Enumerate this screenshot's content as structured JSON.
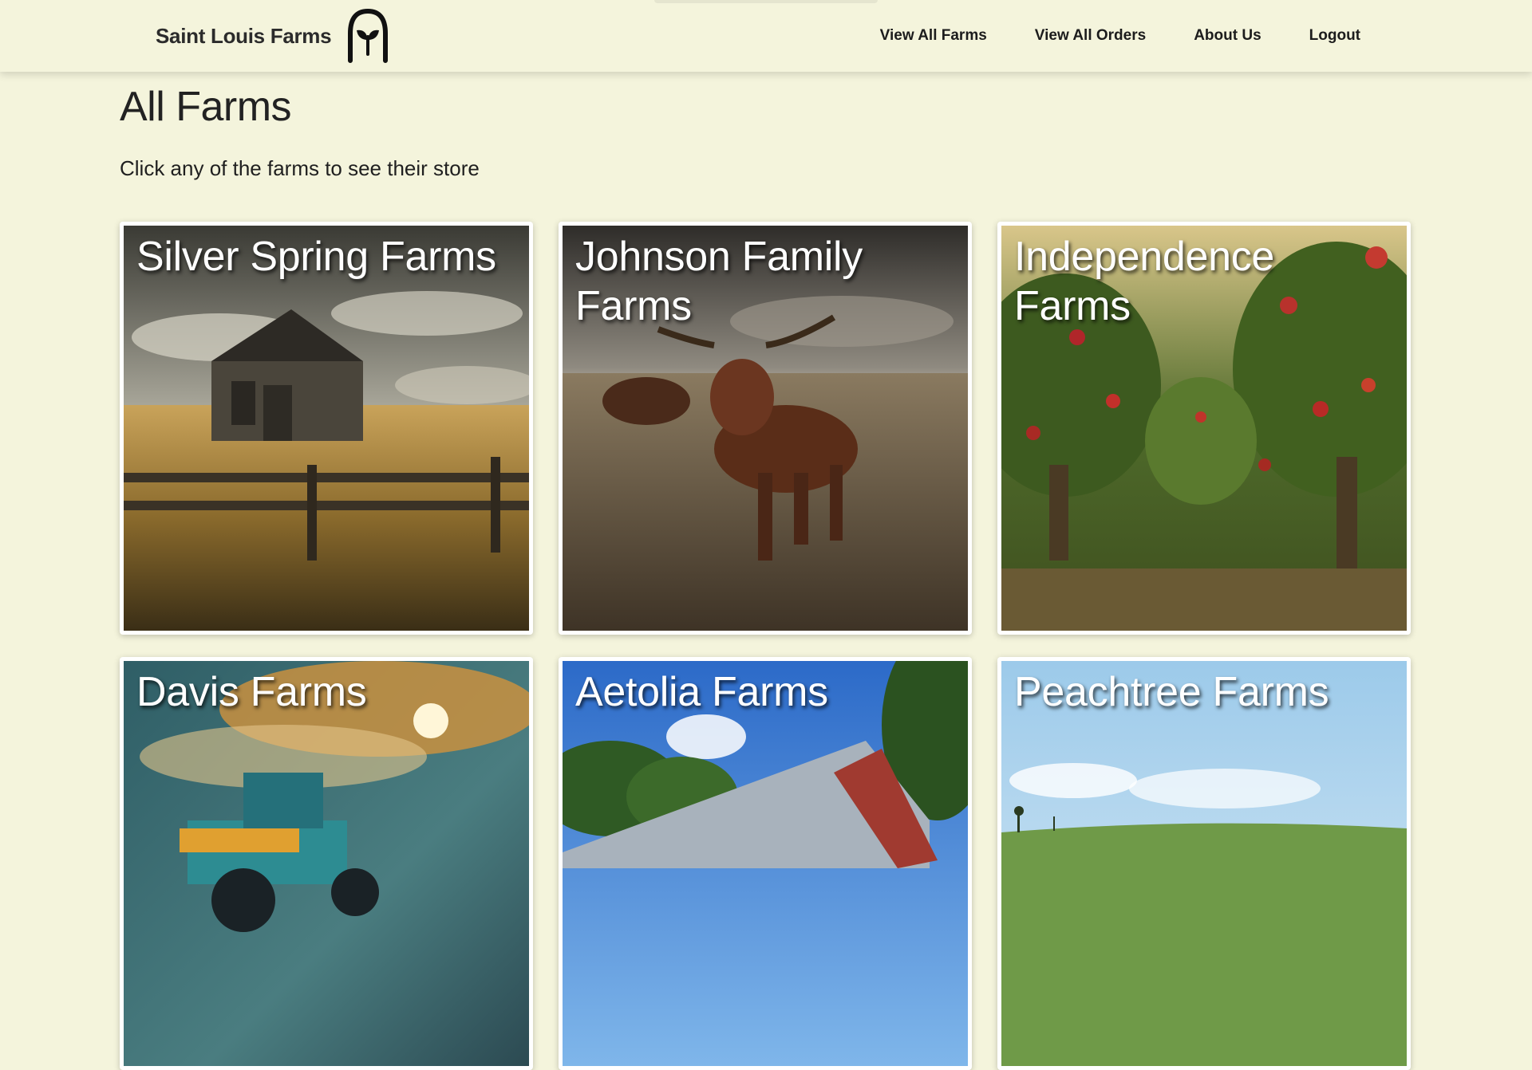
{
  "brand": {
    "name": "Saint Louis Farms",
    "logo_icon": "sprout-arch-logo"
  },
  "nav": {
    "items": [
      {
        "label": "View All Farms"
      },
      {
        "label": "View All Orders"
      },
      {
        "label": "About Us"
      },
      {
        "label": "Logout"
      }
    ]
  },
  "page": {
    "title": "All Farms",
    "subtitle": "Click any of the farms to see their store"
  },
  "farms": [
    {
      "name": "Silver Spring Farms",
      "image": "barn-with-fence"
    },
    {
      "name": "Johnson Family Farms",
      "image": "cattle-in-field"
    },
    {
      "name": "Independence Farms",
      "image": "apple-orchard"
    },
    {
      "name": "Davis Farms",
      "image": "tractor-under-sun"
    },
    {
      "name": "Aetolia Farms",
      "image": "red-barn-blue-sky"
    },
    {
      "name": "Peachtree Farms",
      "image": "green-hills-sky"
    }
  ],
  "colors": {
    "background": "#f4f4dc",
    "text": "#1f1f1f",
    "card_border": "#ffffff"
  }
}
